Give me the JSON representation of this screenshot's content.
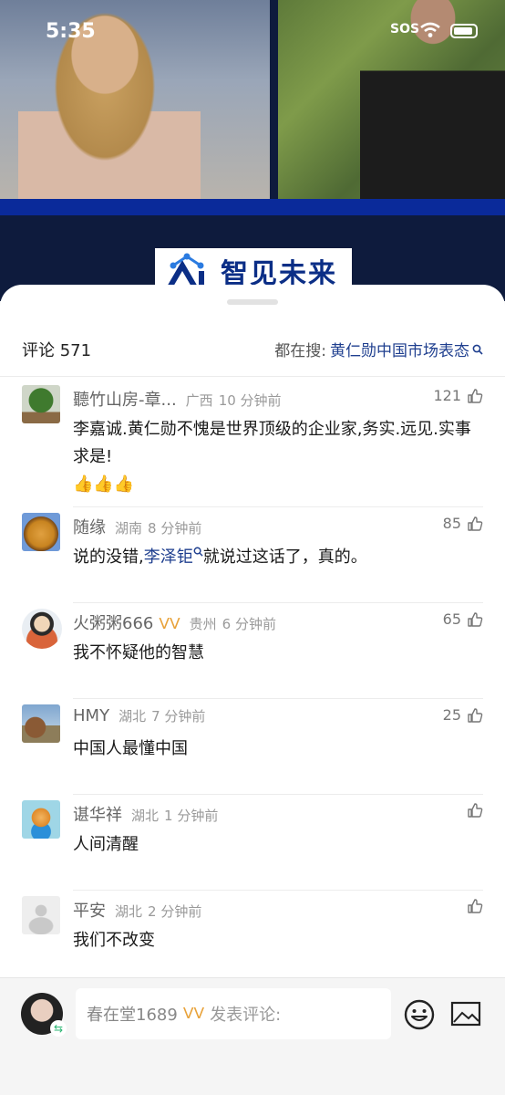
{
  "status_bar": {
    "time": "5:35",
    "sos": "SOS"
  },
  "video": {
    "logo_text": "智见未来"
  },
  "header": {
    "comment_label": "评论 571",
    "search_prefix": "都在搜:",
    "search_term": "黄仁勋中国市场表态"
  },
  "comments": [
    {
      "name": "聽竹山房-章...",
      "badge": "",
      "location": "广西",
      "time": "10 分钟前",
      "likes": "121",
      "text": "李嘉诚.黄仁勋不愧是世界顶级的企业家,务实.远见.实事求是!",
      "emoji": "👍👍👍"
    },
    {
      "name": "随缘",
      "badge": "",
      "location": "湖南",
      "time": "8 分钟前",
      "likes": "85",
      "text_before": "说的没错,",
      "mention": "李泽钜",
      "text_after": "就说过这话了，真的。"
    },
    {
      "name": "火粥粥666",
      "badge": "ᐯᐯ",
      "location": "贵州",
      "time": "6 分钟前",
      "likes": "65",
      "text": "我不怀疑他的智慧"
    },
    {
      "name": "HMY",
      "badge": "",
      "location": "湖北",
      "time": "7 分钟前",
      "likes": "25",
      "text": "中国人最懂中国"
    },
    {
      "name": "谌华祥",
      "badge": "",
      "location": "湖北",
      "time": "1 分钟前",
      "likes": "",
      "text": "人间清醒"
    },
    {
      "name": "平安",
      "badge": "",
      "location": "湖北",
      "time": "2 分钟前",
      "likes": "",
      "text": "我们不改变"
    }
  ],
  "composer": {
    "username": "春在堂1689",
    "badge": "ᐯᐯ",
    "placeholder": "发表评论:",
    "emoji_icon": "smiley-icon",
    "image_icon": "image-icon"
  },
  "colors": {
    "link": "#1f3f8f",
    "badge": "#e8a23a",
    "brand": "#0b2e86"
  }
}
